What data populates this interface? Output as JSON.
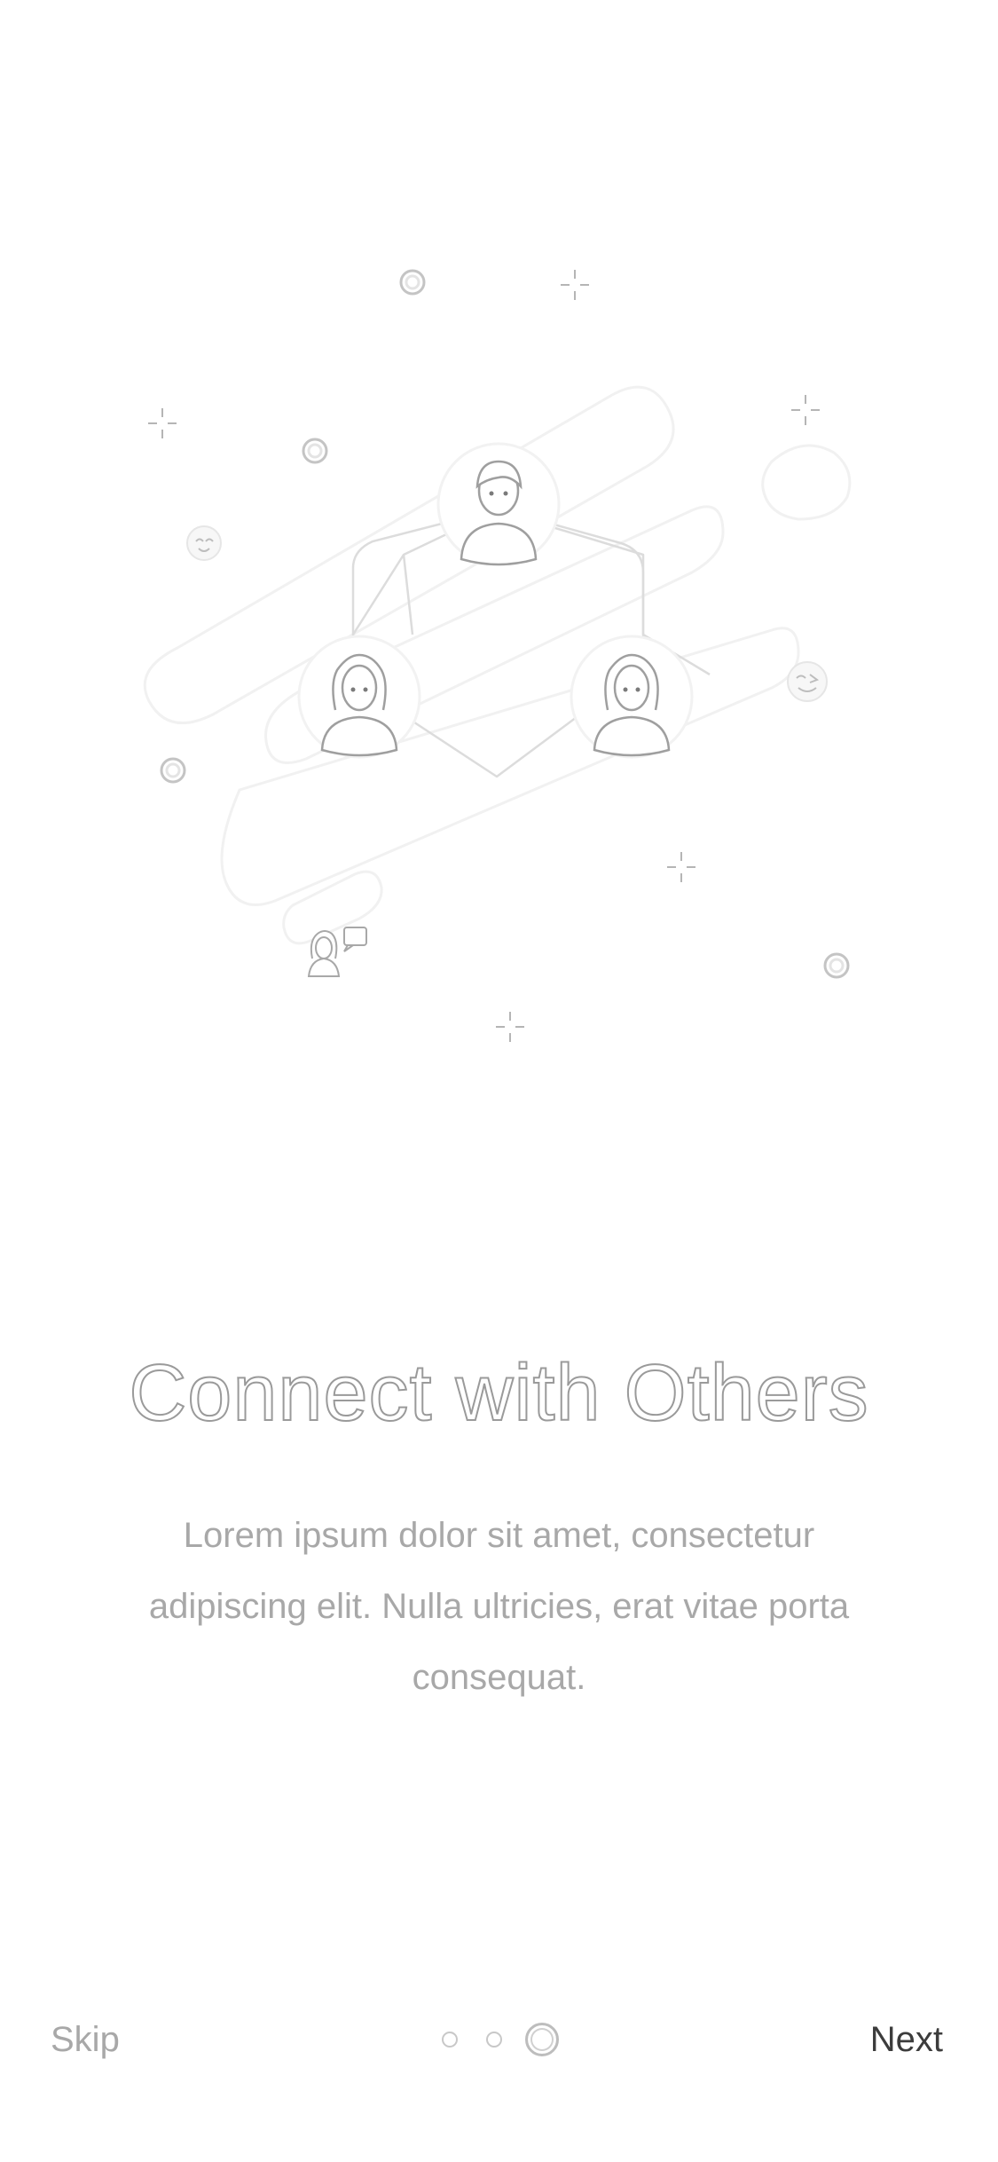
{
  "onboarding": {
    "title": "Connect with Others",
    "description": "Lorem ipsum dolor sit amet, consectetur adipiscing elit. Nulla ultricies, erat vitae porta consequat.",
    "illustration_icons": [
      "network-illustration",
      "person-male-icon",
      "person-female-icon",
      "person-female-icon",
      "smile-emoji-icon",
      "wink-emoji-icon",
      "chat-person-icon",
      "sparkle-icon",
      "ring-icon"
    ]
  },
  "footer": {
    "skip_label": "Skip",
    "next_label": "Next",
    "page_indicator": {
      "total": 3,
      "current": 3
    }
  },
  "colors": {
    "background": "#ffffff",
    "title_outline": "#9a9a9a",
    "body_text": "#a8a8a8",
    "next_text": "#3c3c3c",
    "illustration_stroke": "#cfcfcf"
  }
}
